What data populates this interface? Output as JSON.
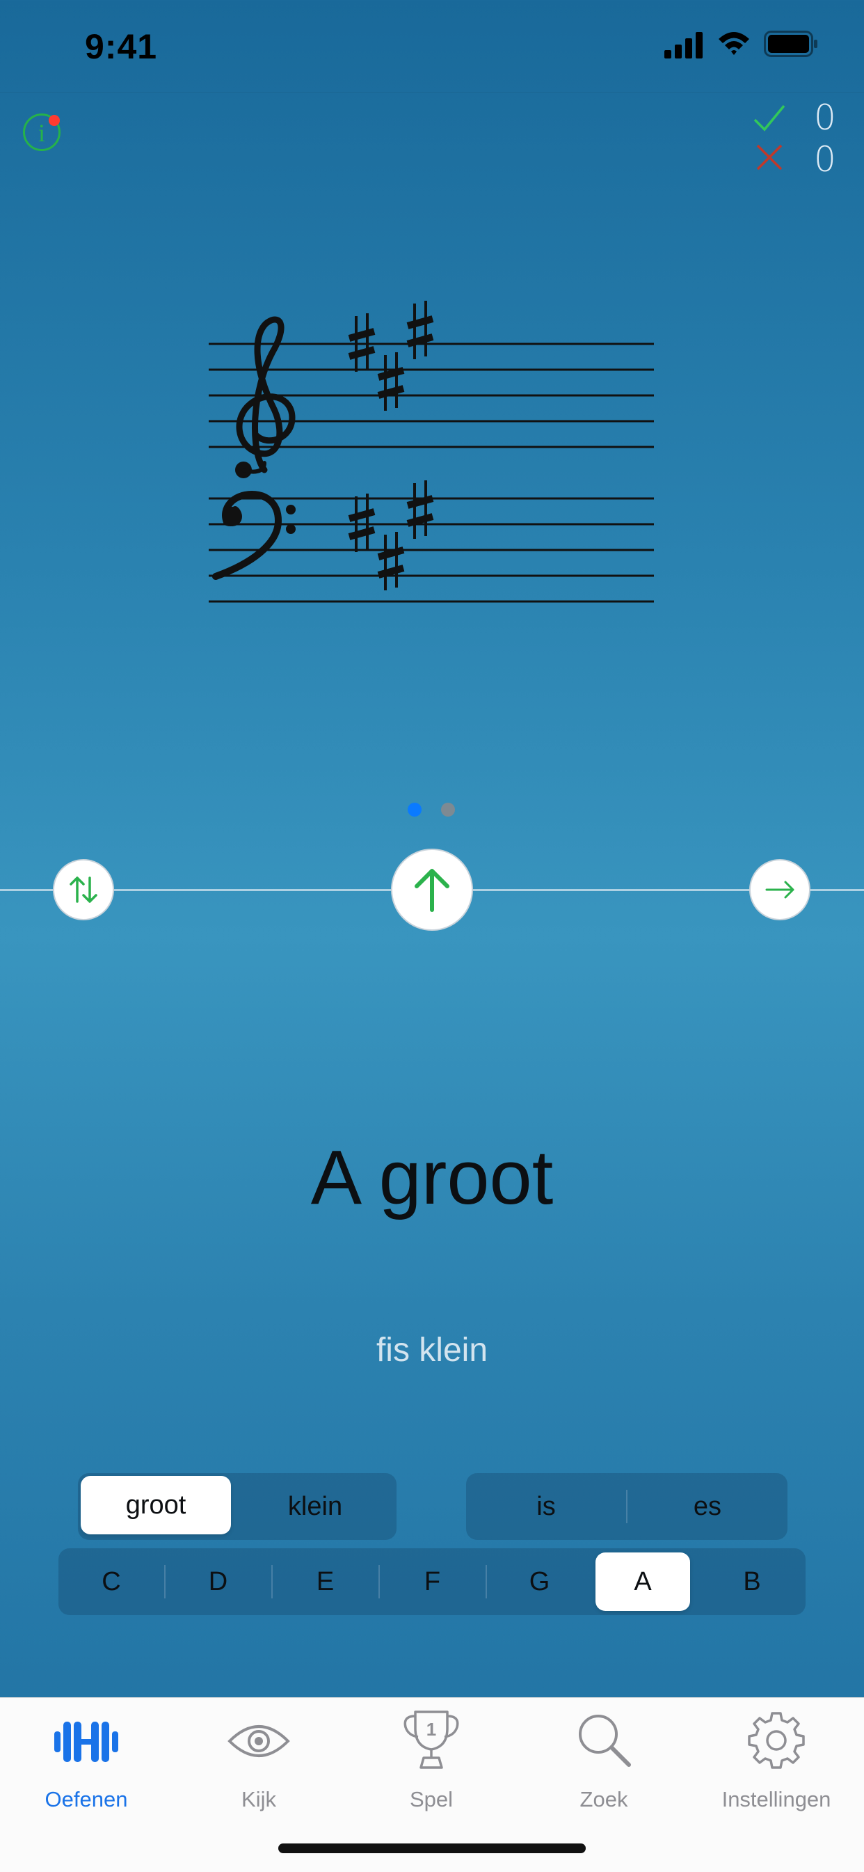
{
  "status_bar": {
    "time": "9:41"
  },
  "score": {
    "correct": "0",
    "wrong": "0",
    "correct_color": "#32c85a",
    "wrong_color": "#c0392b"
  },
  "info_button": {
    "icon": "info-icon",
    "label": "i"
  },
  "staff": {
    "key_signature": "A major",
    "sharps": 3,
    "clefs": [
      "treble-clef",
      "bass-clef"
    ]
  },
  "pager": {
    "count": 2,
    "active_index": 0,
    "active_color": "#0a7aff",
    "inactive_color": "#7d8a93"
  },
  "controls": {
    "left_button_icon": "up-down-arrows-icon",
    "center_button_icon": "arrow-up-icon",
    "right_button_icon": "arrow-right-icon",
    "accent": "#2bb24c"
  },
  "answer": {
    "main": "A groot",
    "secondary": "fis klein"
  },
  "case_selector": {
    "options": [
      "groot",
      "klein"
    ],
    "selected": "groot"
  },
  "accidental_selector": {
    "options": [
      "is",
      "es"
    ],
    "selected": ""
  },
  "note_selector": {
    "options": [
      "C",
      "D",
      "E",
      "F",
      "G",
      "A",
      "B"
    ],
    "selected": "A"
  },
  "tabs": [
    {
      "label": "Oefenen",
      "icon": "dumbbell-icon",
      "active": true
    },
    {
      "label": "Kijk",
      "icon": "eye-icon",
      "active": false
    },
    {
      "label": "Spel",
      "icon": "trophy-icon",
      "active": false
    },
    {
      "label": "Zoek",
      "icon": "magnifier-icon",
      "active": false
    },
    {
      "label": "Instellingen",
      "icon": "gear-icon",
      "active": false
    }
  ]
}
